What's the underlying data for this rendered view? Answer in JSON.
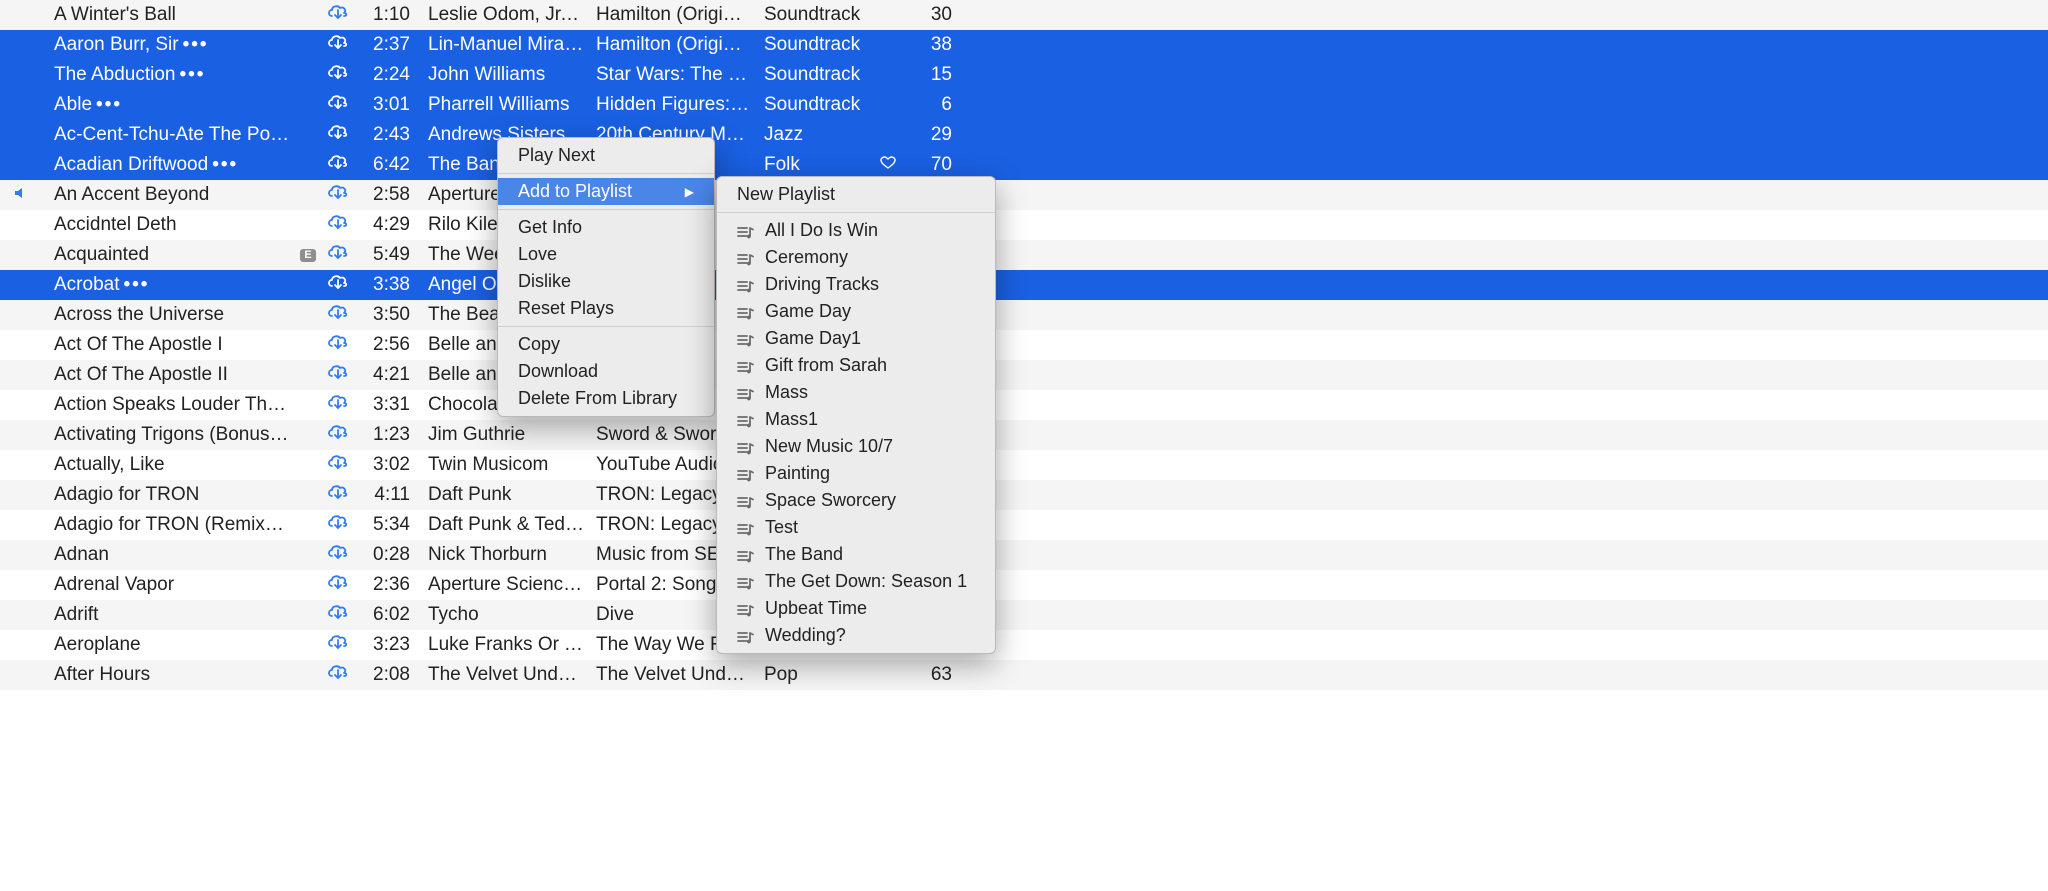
{
  "tracks": [
    {
      "name": "A Winter's Ball",
      "more": false,
      "speaker": false,
      "explicit": false,
      "cloud": true,
      "time": "1:10",
      "artist": "Leslie Odom, Jr., L…",
      "album": "Hamilton (Original…",
      "genre": "Soundtrack",
      "love": false,
      "plays": "30",
      "selected": false
    },
    {
      "name": "Aaron Burr, Sir",
      "more": true,
      "speaker": false,
      "explicit": false,
      "cloud": true,
      "time": "2:37",
      "artist": "Lin-Manuel Miran…",
      "album": "Hamilton (Original…",
      "genre": "Soundtrack",
      "love": false,
      "plays": "38",
      "selected": true
    },
    {
      "name": "The Abduction",
      "more": true,
      "speaker": false,
      "explicit": false,
      "cloud": true,
      "time": "2:24",
      "artist": "John Williams",
      "album": "Star Wars: The For…",
      "genre": "Soundtrack",
      "love": false,
      "plays": "15",
      "selected": true
    },
    {
      "name": "Able",
      "more": true,
      "speaker": false,
      "explicit": false,
      "cloud": true,
      "time": "3:01",
      "artist": "Pharrell Williams",
      "album": "Hidden Figures: T…",
      "genre": "Soundtrack",
      "love": false,
      "plays": "6",
      "selected": true
    },
    {
      "name": "Ac-Cent-Tchu-Ate The Posi…",
      "more": true,
      "speaker": false,
      "explicit": false,
      "cloud": true,
      "time": "2:43",
      "artist": "Andrews Sisters",
      "album": "20th Century Mast…",
      "genre": "Jazz",
      "love": false,
      "plays": "29",
      "selected": true
    },
    {
      "name": "Acadian Driftwood",
      "more": true,
      "speaker": false,
      "explicit": false,
      "cloud": true,
      "time": "6:42",
      "artist": "The Band",
      "album": "es…",
      "genre": "Folk",
      "love": true,
      "plays": "70",
      "selected": true
    },
    {
      "name": "An Accent Beyond",
      "more": false,
      "speaker": true,
      "explicit": false,
      "cloud": true,
      "time": "2:58",
      "artist": "Aperture ",
      "album": "",
      "genre": "",
      "love": false,
      "plays": "",
      "selected": false
    },
    {
      "name": "Accidntel Deth",
      "more": false,
      "speaker": false,
      "explicit": false,
      "cloud": true,
      "time": "4:29",
      "artist": "Rilo Kiley",
      "album": "",
      "genre": "",
      "love": false,
      "plays": "",
      "selected": false
    },
    {
      "name": "Acquainted",
      "more": false,
      "speaker": false,
      "explicit": true,
      "cloud": true,
      "time": "5:49",
      "artist": "The Week",
      "album": "",
      "genre": "",
      "love": false,
      "plays": "",
      "selected": false
    },
    {
      "name": "Acrobat",
      "more": true,
      "speaker": false,
      "explicit": false,
      "cloud": true,
      "time": "3:38",
      "artist": "Angel Ols",
      "album": "",
      "genre": "",
      "love": false,
      "plays": "",
      "selected": true
    },
    {
      "name": "Across the Universe",
      "more": false,
      "speaker": false,
      "explicit": false,
      "cloud": true,
      "time": "3:50",
      "artist": "The Beatl",
      "album": "",
      "genre": "",
      "love": false,
      "plays": "",
      "selected": false
    },
    {
      "name": "Act Of The Apostle I",
      "more": false,
      "speaker": false,
      "explicit": false,
      "cloud": true,
      "time": "2:56",
      "artist": "Belle and",
      "album": "",
      "genre": "",
      "love": false,
      "plays": "",
      "selected": false
    },
    {
      "name": "Act Of The Apostle II",
      "more": false,
      "speaker": false,
      "explicit": false,
      "cloud": true,
      "time": "4:21",
      "artist": "Belle and",
      "album": "",
      "genre": "",
      "love": false,
      "plays": "",
      "selected": false
    },
    {
      "name": "Action Speaks Louder Than Wor…",
      "more": false,
      "speaker": false,
      "explicit": false,
      "cloud": true,
      "time": "3:31",
      "artist": "Chocolate",
      "album": "",
      "genre": "",
      "love": false,
      "plays": "",
      "selected": false
    },
    {
      "name": "Activating Trigons (Bonus Track)",
      "more": false,
      "speaker": false,
      "explicit": false,
      "cloud": true,
      "time": "1:23",
      "artist": "Jim Guthrie",
      "album": "Sword & Sworcer",
      "genre": "",
      "love": false,
      "plays": "",
      "selected": false
    },
    {
      "name": "Actually, Like",
      "more": false,
      "speaker": false,
      "explicit": false,
      "cloud": true,
      "time": "3:02",
      "artist": "Twin Musicom",
      "album": "YouTube Audio Li",
      "genre": "",
      "love": false,
      "plays": "",
      "selected": false
    },
    {
      "name": "Adagio for TRON",
      "more": false,
      "speaker": false,
      "explicit": false,
      "cloud": true,
      "time": "4:11",
      "artist": "Daft Punk",
      "album": "TRON: Legacy",
      "genre": "",
      "love": false,
      "plays": "",
      "selected": false
    },
    {
      "name": "Adagio for TRON (Remixed by T…",
      "more": false,
      "speaker": false,
      "explicit": false,
      "cloud": true,
      "time": "5:34",
      "artist": "Daft Punk & Tedd…",
      "album": "TRON: Legacy Re",
      "genre": "",
      "love": false,
      "plays": "",
      "selected": false
    },
    {
      "name": "Adnan",
      "more": false,
      "speaker": false,
      "explicit": false,
      "cloud": true,
      "time": "0:28",
      "artist": "Nick Thorburn",
      "album": "Music from SERIA",
      "genre": "",
      "love": false,
      "plays": "",
      "selected": false
    },
    {
      "name": "Adrenal Vapor",
      "more": false,
      "speaker": false,
      "explicit": false,
      "cloud": true,
      "time": "2:36",
      "artist": "Aperture Scienc…",
      "album": "Portal 2: Songs t",
      "genre": "",
      "love": false,
      "plays": "",
      "selected": false
    },
    {
      "name": "Adrift",
      "more": false,
      "speaker": false,
      "explicit": false,
      "cloud": true,
      "time": "6:02",
      "artist": "Tycho",
      "album": "Dive",
      "genre": "",
      "love": false,
      "plays": "",
      "selected": false
    },
    {
      "name": "Aeroplane",
      "more": false,
      "speaker": false,
      "explicit": false,
      "cloud": true,
      "time": "3:23",
      "artist": "Luke Franks Or Th…",
      "album": "The Way We Ran",
      "genre": "",
      "love": false,
      "plays": "",
      "selected": false
    },
    {
      "name": "After Hours",
      "more": false,
      "speaker": false,
      "explicit": false,
      "cloud": true,
      "time": "2:08",
      "artist": "The Velvet Under…",
      "album": "The Velvet Under…",
      "genre": "Pop",
      "love": false,
      "plays": "63",
      "selected": false
    }
  ],
  "context": {
    "items1": [
      "Play Next"
    ],
    "add_label": "Add to Playlist",
    "items2": [
      "Get Info",
      "Love",
      "Dislike",
      "Reset Plays"
    ],
    "items3": [
      "Copy",
      "Download",
      "Delete From Library"
    ]
  },
  "submenu": {
    "new_label": "New Playlist",
    "playlists": [
      "All I Do Is Win",
      "Ceremony",
      "Driving Tracks",
      "Game Day",
      "Game Day1",
      "Gift from Sarah",
      "Mass",
      "Mass1",
      "New Music 10/7",
      "Painting",
      "Space Sworcery",
      "Test",
      "The Band",
      "The Get Down: Season 1",
      "Upbeat Time",
      "Wedding?"
    ]
  },
  "explicit_badge": "E"
}
